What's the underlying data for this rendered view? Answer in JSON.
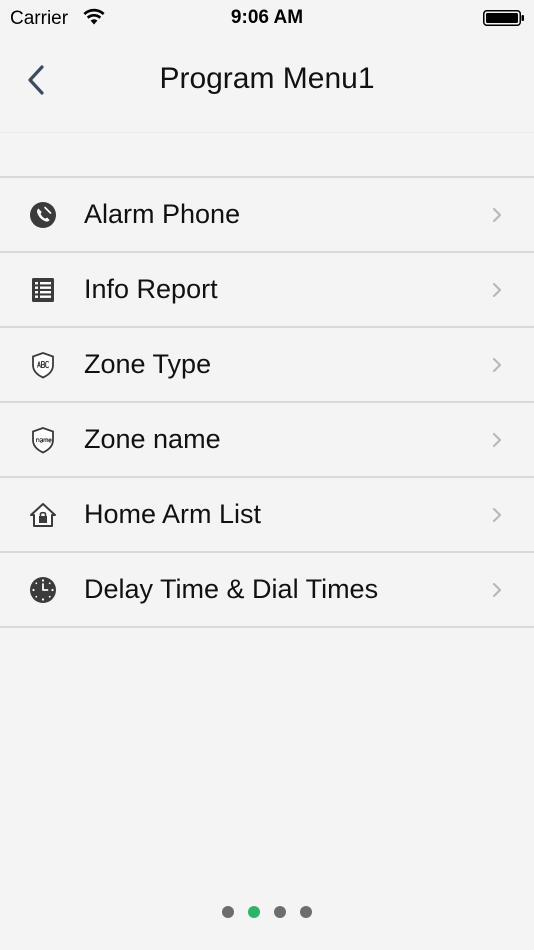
{
  "status_bar": {
    "carrier": "Carrier",
    "time": "9:06 AM",
    "wifi_icon": "wifi-icon",
    "battery_icon": "battery-icon"
  },
  "nav": {
    "title": "Program Menu1",
    "back_icon": "chevron-left-icon"
  },
  "menu": {
    "items": [
      {
        "label": "Alarm Phone",
        "icon": "phone-icon"
      },
      {
        "label": "Info Report",
        "icon": "list-icon"
      },
      {
        "label": "Zone Type",
        "icon": "shield-abc-icon"
      },
      {
        "label": "Zone name",
        "icon": "shield-name-icon"
      },
      {
        "label": "Home Arm List",
        "icon": "home-lock-icon"
      },
      {
        "label": "Delay Time & Dial Times",
        "icon": "clock-icon"
      }
    ]
  },
  "pager": {
    "count": 4,
    "active_index": 1,
    "active_color": "#2eb36b",
    "inactive_color": "#6d6d6d"
  }
}
